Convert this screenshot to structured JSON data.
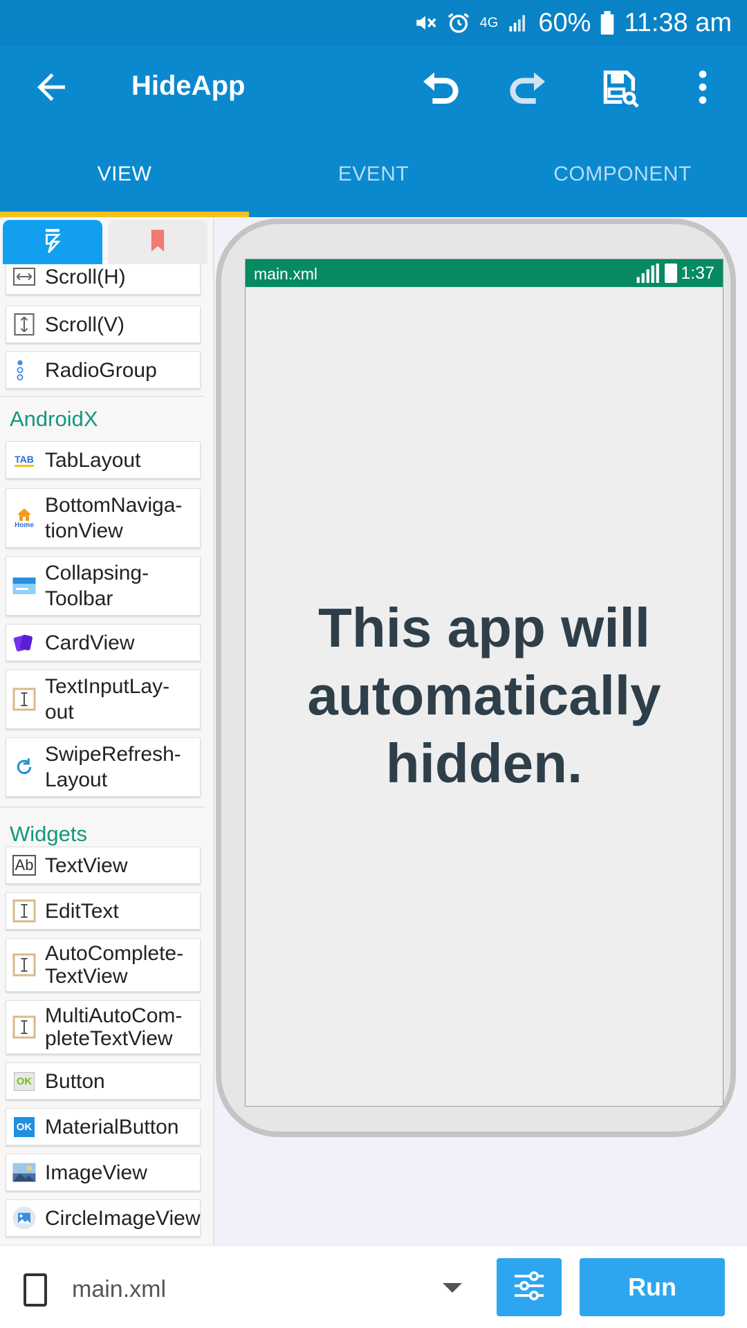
{
  "status_bar": {
    "battery": "60%",
    "time": "11:38 am",
    "network": "4G"
  },
  "app_bar": {
    "title": "HideApp"
  },
  "tabs": [
    {
      "label": "VIEW"
    },
    {
      "label": "EVENT"
    },
    {
      "label": "COMPONENT"
    }
  ],
  "palette": {
    "layouts": [
      {
        "label": "Scroll(H)",
        "icon": "scroll-h-icon"
      },
      {
        "label": "Scroll(V)",
        "icon": "scroll-v-icon"
      },
      {
        "label": "RadioGroup",
        "icon": "radiogroup-icon"
      }
    ],
    "androidx_title": "AndroidX",
    "androidx": [
      {
        "label": "TabLayout",
        "icon": "tab-icon"
      },
      {
        "label": "BottomNaviga-\ntionView",
        "icon": "home-icon"
      },
      {
        "label": "Collapsing-\nToolbar",
        "icon": "toolbar-icon"
      },
      {
        "label": "CardView",
        "icon": "cards-icon"
      },
      {
        "label": "TextInputLay-\nout",
        "icon": "text-cursor-icon"
      },
      {
        "label": "SwipeRefresh-\nLayout",
        "icon": "refresh-icon"
      }
    ],
    "widgets_title": "Widgets",
    "widgets": [
      {
        "label": "TextView",
        "icon": "ab-text-icon"
      },
      {
        "label": "EditText",
        "icon": "text-cursor-icon"
      },
      {
        "label": "AutoComplete-\nTextView",
        "icon": "text-cursor-icon"
      },
      {
        "label": "MultiAutoCom-\npleteTextView",
        "icon": "text-cursor-icon"
      },
      {
        "label": "Button",
        "icon": "ok-button-icon"
      },
      {
        "label": "MaterialButton",
        "icon": "ok-material-icon"
      },
      {
        "label": "ImageView",
        "icon": "image-icon"
      },
      {
        "label": "CircleImageView",
        "icon": "circle-image-icon"
      }
    ],
    "ok_text": "OK",
    "tab_text": "TAB",
    "home_text": "Home",
    "ab_text": "Ab"
  },
  "preview": {
    "file": "main.xml",
    "time": "1:37",
    "message": "This app will automatically hidden.",
    "colors": {
      "status": "#078a62",
      "text": "#2f3f4a"
    }
  },
  "bottom_bar": {
    "file": "main.xml",
    "run_label": "Run"
  },
  "colors": {
    "primary": "#0a89cf",
    "accent": "#f4c21a",
    "button": "#2ea6ef"
  }
}
